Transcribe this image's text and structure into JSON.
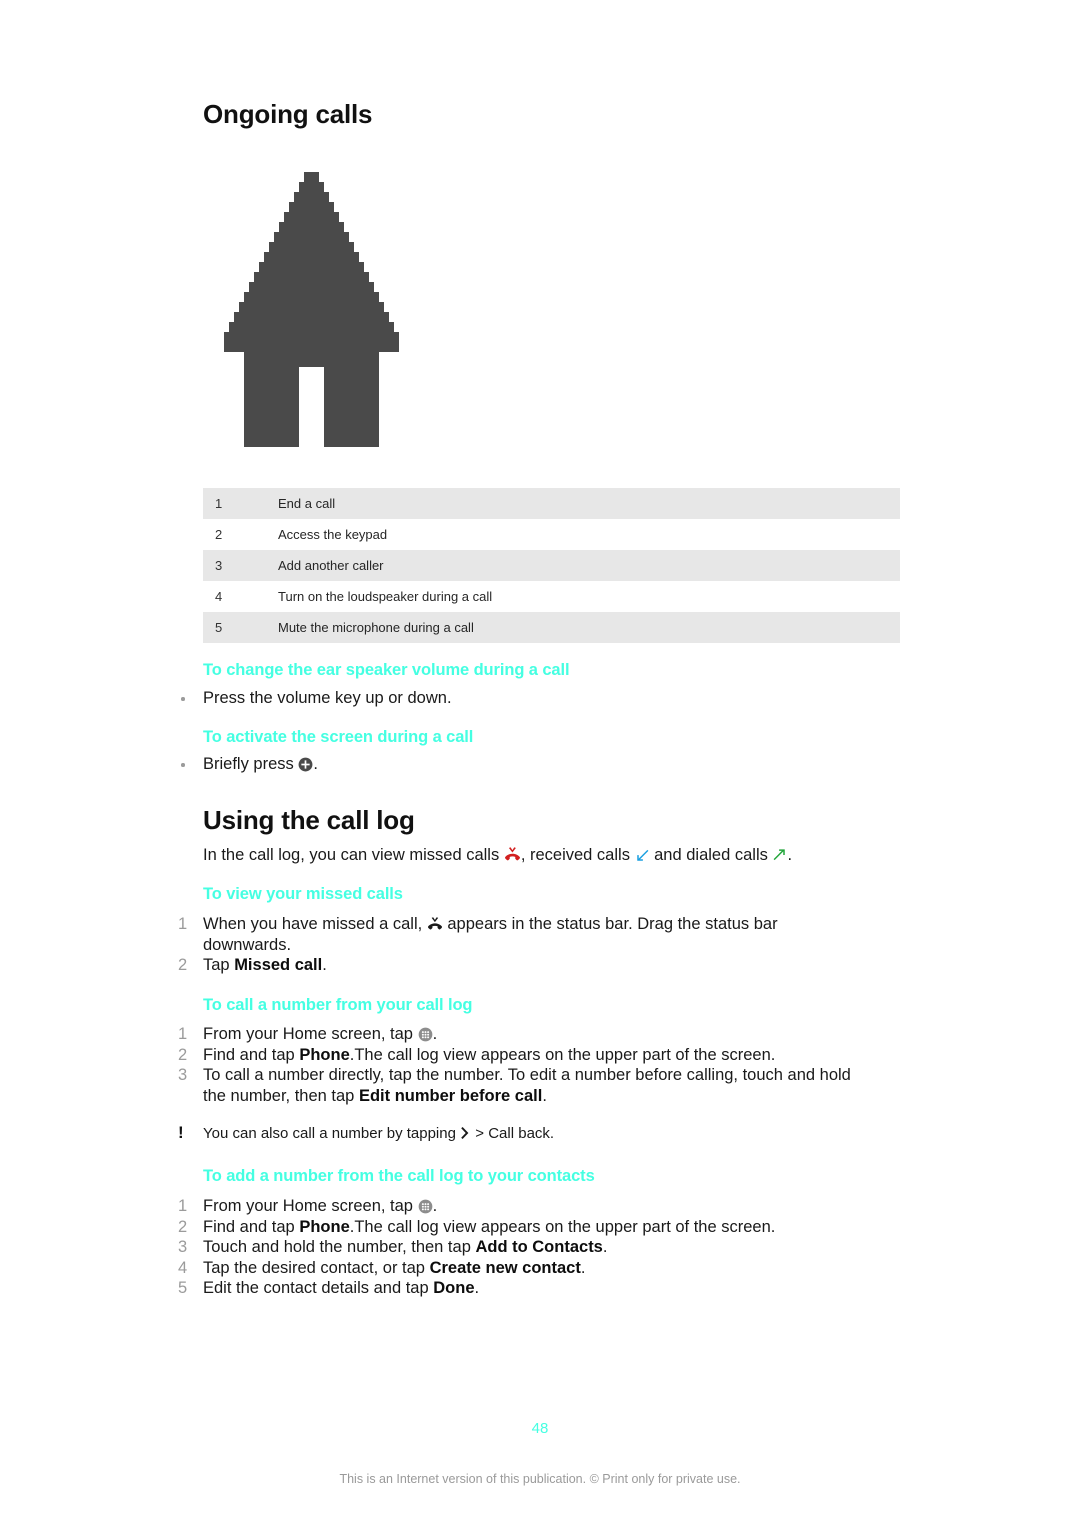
{
  "document": {
    "page_number": "48",
    "footer_note": "This is an Internet version of this publication. © Print only for private use.",
    "accent_color": "#45FFE2"
  },
  "sections": {
    "ongoing_calls": {
      "title": "Ongoing calls",
      "image_alt": "pixelated-up-arrow-callout",
      "legend": {
        "rows": [
          {
            "num": "1",
            "desc": "End a call"
          },
          {
            "num": "2",
            "desc": "Access the keypad"
          },
          {
            "num": "3",
            "desc": "Add another caller"
          },
          {
            "num": "4",
            "desc": "Turn on the loudspeaker during a call"
          },
          {
            "num": "5",
            "desc": "Mute the microphone during a call"
          }
        ]
      },
      "proc_volume": {
        "title": "To change the ear speaker volume during a call",
        "step1": "Press the volume key up or down."
      },
      "proc_activate": {
        "title": "To activate the screen during a call",
        "step1_pre": "Briefly press ",
        "step1_post": "."
      }
    },
    "using_call_log": {
      "title": "Using the call log",
      "intro_a": "In the call log, you can view missed calls ",
      "intro_b": ", received calls ",
      "intro_c": " and dialed calls ",
      "intro_d": ".",
      "proc_missed": {
        "title": "To view your missed calls",
        "step1_a": "When you have missed a call, ",
        "step1_b": " appears in the status bar. Drag the status bar downwards.",
        "step2_pre": "Tap ",
        "step2_bold": "Missed call",
        "step2_post": "."
      },
      "proc_call_number": {
        "title": "To call a number from your call log",
        "step1_pre": "From your Home screen, tap ",
        "step1_post": ".",
        "step2_pre": "Find and tap ",
        "step2_bold": "Phone",
        "step2_post": ".The call log view appears on the upper part of the screen.",
        "step3_pre": "To call a number directly, tap the number. To edit a number before calling, touch and hold the number, then tap ",
        "step3_bold": "Edit number before call",
        "step3_post": ".",
        "tip_pre": "You can also call a number by tapping ",
        "tip_post": " > Call back."
      },
      "proc_add_contact": {
        "title": "To add a number from the call log to your contacts",
        "step1_pre": "From your Home screen, tap ",
        "step1_post": ".",
        "step2_pre": "Find and tap ",
        "step2_bold": "Phone",
        "step2_post": ".The call log view appears on the upper part of the screen.",
        "step3_pre": "Touch and hold the number, then tap ",
        "step3_bold": "Add to Contacts",
        "step3_post": ".",
        "step4_pre": "Tap the desired contact, or tap ",
        "step4_bold": "Create new contact",
        "step4_post": ".",
        "step5_pre": "Edit the contact details and tap ",
        "step5_bold": "Done",
        "step5_post": "."
      }
    }
  },
  "markers": {
    "n1": "1",
    "n2": "2",
    "n3": "3",
    "n4": "4",
    "n5": "5",
    "bang": "!"
  },
  "icons": {
    "missed_call_red": "missed-call-icon",
    "missed_call_black": "missed-call-status-icon",
    "received_call": "received-call-arrow-icon",
    "dialed_call": "dialed-call-arrow-icon",
    "power_plus": "power-plus-button-icon",
    "app_drawer": "app-drawer-icon",
    "chevron": "chevron-right-icon"
  }
}
